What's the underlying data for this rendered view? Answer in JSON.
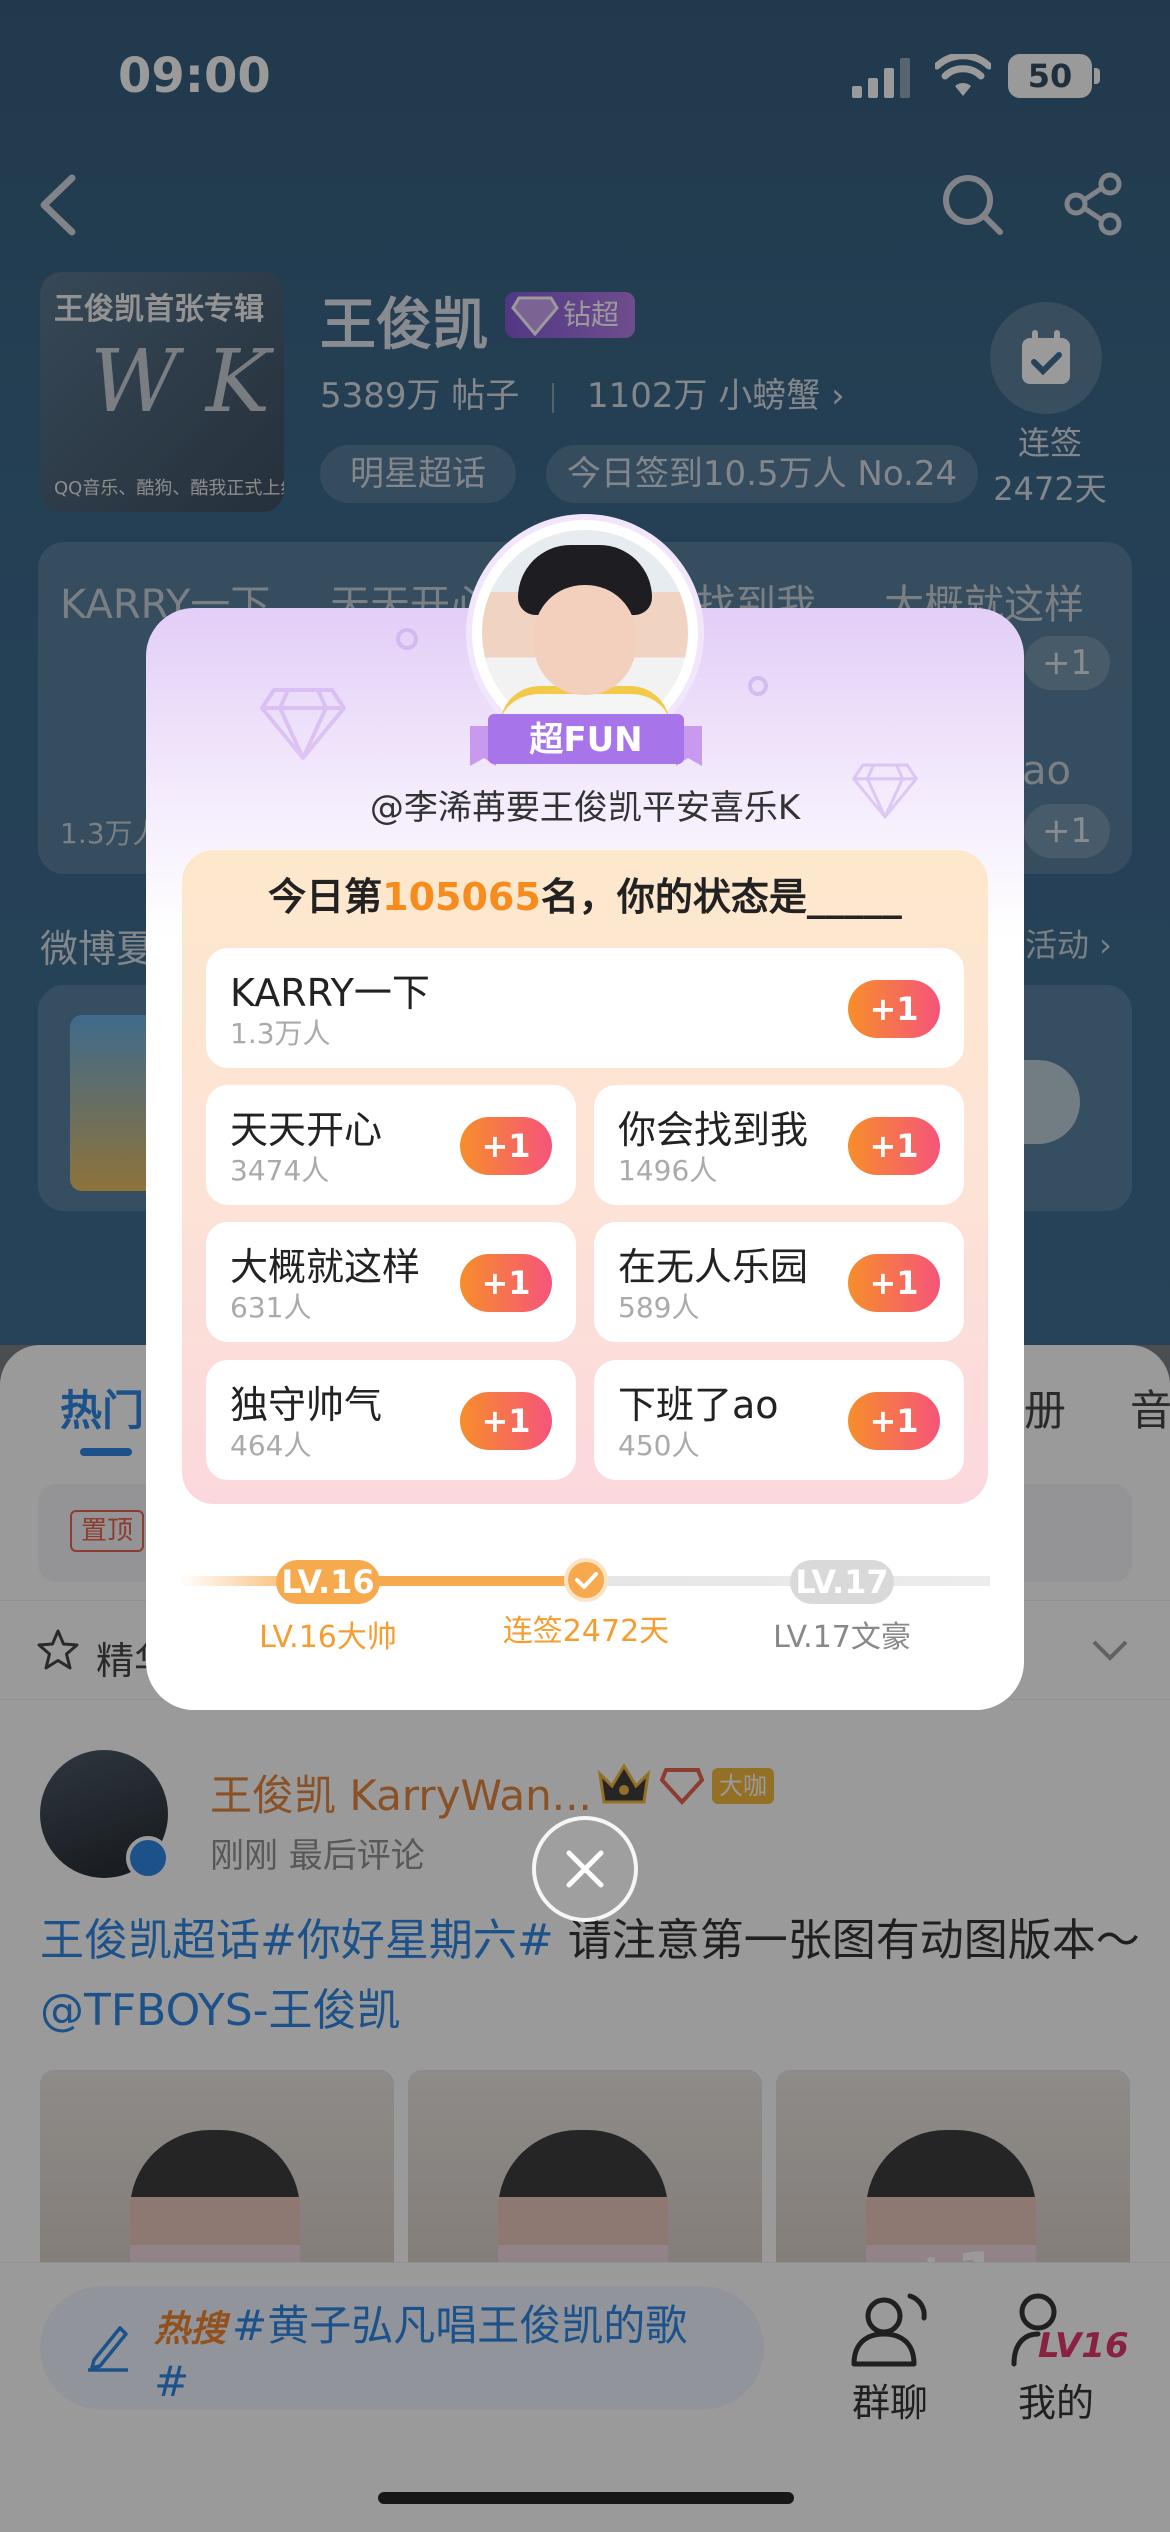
{
  "status_bar": {
    "time": "09:00",
    "battery": "50"
  },
  "header": {
    "cover_title": "王俊凯首张专辑",
    "cover_art": "W K",
    "cover_subtitle": "QQ音乐、酷狗、酷我正式上线",
    "title": "王俊凯",
    "badge": "钻超",
    "posts_count": "5389万",
    "posts_label": "帖子",
    "fans_count": "1102万",
    "fans_label": "小螃蟹 ›",
    "tag_star": "明星超话",
    "tag_checkin": "今日签到10.5万人 No.24",
    "checkin_label": "连签",
    "checkin_days": "2472天"
  },
  "background_grid": {
    "cells": [
      "KARRY一下",
      "天天开心",
      "找到我",
      "大概就这样",
      "ao"
    ],
    "count": "1.3万人",
    "plus": "+1"
  },
  "weibo": {
    "label": "微博夏",
    "more": "活动 ›"
  },
  "tabs": {
    "hot": "热门",
    "album": "册",
    "music": "音"
  },
  "pinned_tag": "置顶",
  "featured_label": "精华",
  "post": {
    "author": "王俊凯 KarryWan...",
    "badge": "大咖",
    "meta": "刚刚  最后评论",
    "text_topic": "王俊凯超话#你好星期六#",
    "text_body": " 请注意第一张图有动图版本～",
    "text_mention": "@TFBOYS-王俊凯",
    "image_overlay": "+1"
  },
  "bottom": {
    "hot_tag": "热搜",
    "hot_text": "#黄子弘凡唱王俊凯的歌#",
    "group_chat": "群聊",
    "mine": "我的",
    "level": "LV16"
  },
  "modal": {
    "ribbon": "超FUN",
    "username": "@李浠苒要王俊凯平安喜乐K",
    "heading_prefix": "今日第",
    "heading_rank": "105065",
    "heading_suffix": "名，你的状态是_____",
    "options": [
      {
        "name": "KARRY一下",
        "count": "1.3万人",
        "action": "+1"
      },
      {
        "name": "天天开心",
        "count": "3474人",
        "action": "+1"
      },
      {
        "name": "你会找到我",
        "count": "1496人",
        "action": "+1"
      },
      {
        "name": "大概就这样",
        "count": "631人",
        "action": "+1"
      },
      {
        "name": "在无人乐园",
        "count": "589人",
        "action": "+1"
      },
      {
        "name": "独守帅气",
        "count": "464人",
        "action": "+1"
      },
      {
        "name": "下班了ao",
        "count": "450人",
        "action": "+1"
      }
    ],
    "progress": {
      "current_level": "LV.16",
      "current_title": "LV.16大帅",
      "streak": "连签2472天",
      "next_level": "LV.17",
      "next_title": "LV.17文豪"
    }
  },
  "colors": {
    "accent": "#1a7be0",
    "orange": "#f78c1e",
    "purple": "#9a63e0",
    "plus_gradient_start": "#f78e2a",
    "plus_gradient_end": "#f5547a"
  }
}
